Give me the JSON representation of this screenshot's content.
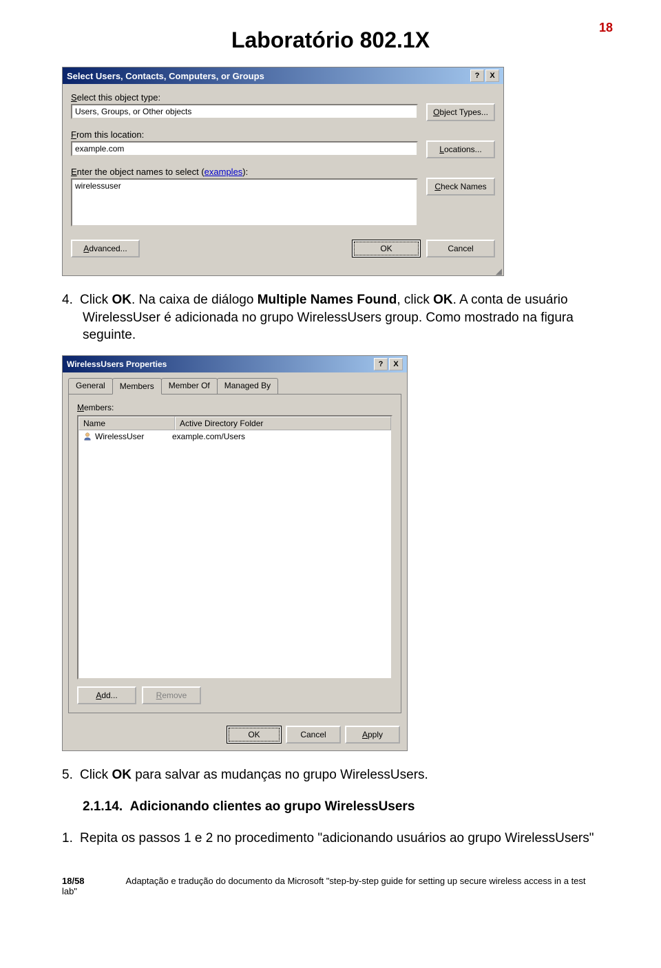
{
  "page": {
    "title": "Laboratório 802.1X",
    "number": "18"
  },
  "dialog1": {
    "title": "Select Users, Contacts, Computers, or Groups",
    "help_btn": "?",
    "close_btn": "X",
    "label_object_type_prefix": "S",
    "label_object_type_rest": "elect this object type:",
    "object_type_value": "Users, Groups, or Other objects",
    "btn_object_types_prefix": "O",
    "btn_object_types_rest": "bject Types...",
    "label_from_prefix": "F",
    "label_from_rest": "rom this location:",
    "from_value": "example.com",
    "btn_locations_prefix": "L",
    "btn_locations_rest": "ocations...",
    "label_enter_prefix": "E",
    "label_enter_rest": "nter the object names to select (",
    "examples_link": "examples",
    "label_enter_suffix": "):",
    "enter_value": "wirelessuser",
    "btn_check_prefix": "C",
    "btn_check_rest": "heck Names",
    "btn_advanced_prefix": "A",
    "btn_advanced_rest": "dvanced...",
    "btn_ok": "OK",
    "btn_cancel": "Cancel"
  },
  "para4": {
    "num": "4.",
    "t1": "Click ",
    "t2": "OK",
    "t3": ". Na caixa de diálogo ",
    "t4": "Multiple Names Found",
    "t5": ", click ",
    "t6": "OK",
    "t7": ". A conta de usuário WirelessUser é adicionada no grupo WirelessUsers group. Como mostrado na figura seguinte."
  },
  "dialog2": {
    "title": "WirelessUsers Properties",
    "help_btn": "?",
    "close_btn": "X",
    "tabs": {
      "general": "General",
      "members": "Members",
      "member_of": "Member Of",
      "managed_by": "Managed By"
    },
    "label_members_prefix": "M",
    "label_members_rest": "embers:",
    "col_name": "Name",
    "col_folder": "Active Directory Folder",
    "row_name": "WirelessUser",
    "row_folder": "example.com/Users",
    "btn_add_prefix": "A",
    "btn_add_rest": "dd...",
    "btn_remove_prefix": "R",
    "btn_remove_rest": "emove",
    "btn_ok": "OK",
    "btn_cancel": "Cancel",
    "btn_apply_prefix": "A",
    "btn_apply_rest": "pply"
  },
  "para5": {
    "num": "5.",
    "t1": "Click ",
    "t2": "OK",
    "t3": " para salvar as mudanças no grupo WirelessUsers."
  },
  "section": {
    "num": "2.1.14.",
    "title": "Adicionando clientes ao grupo WirelessUsers"
  },
  "step1": {
    "num": "1.",
    "text": "Repita os passos 1 e 2 no procedimento \"adicionando usuários ao grupo WirelessUsers\""
  },
  "footer": {
    "pg": "18/58",
    "text": "Adaptação e tradução do documento da Microsoft \"step-by-step guide for setting up secure wireless access in a test lab\""
  }
}
